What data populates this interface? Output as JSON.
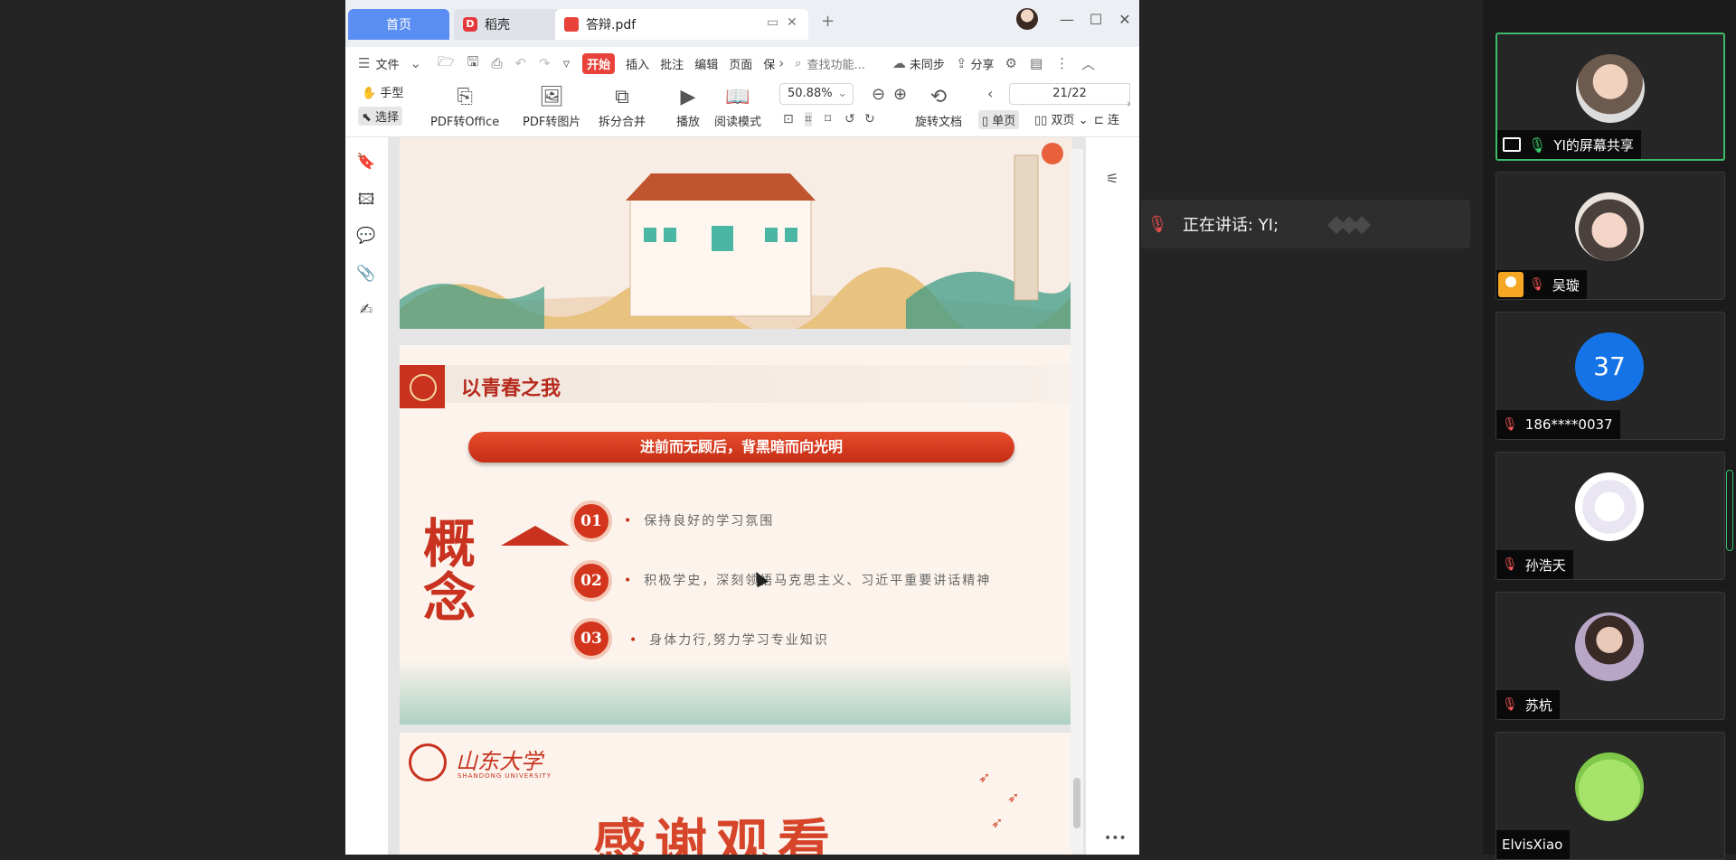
{
  "wps": {
    "tabs": {
      "home": "首页",
      "daoke": "稻壳",
      "pdf": "答辩.pdf"
    },
    "menu": {
      "file": "文件",
      "start": "开始",
      "insert": "插入",
      "annotate": "批注",
      "edit": "编辑",
      "page": "页面",
      "protect": "保",
      "search_placeholder": "查找功能...",
      "unsynced": "未同步",
      "share": "分享"
    },
    "toolbar": {
      "hand": "手型",
      "select": "选择",
      "to_office": "PDF转Office",
      "to_image": "PDF转图片",
      "split_merge": "拆分合并",
      "play": "播放",
      "read_mode": "阅读模式",
      "zoom": "50.88%",
      "page_indicator": "21/22",
      "rotate": "旋转文档",
      "single": "单页",
      "double": "双页",
      "continuous": "连"
    }
  },
  "slides": {
    "s2": {
      "title": "以青春之我",
      "banner": "进前而无顾后，背黑暗而向光明",
      "concept": "概念",
      "points": [
        {
          "num": "01",
          "text": "保持良好的学习氛围"
        },
        {
          "num": "02",
          "text": "积极学史，深刻领悟马克思主义、习近平重要讲话精神"
        },
        {
          "num": "03",
          "text": "身体力行,努力学习专业知识"
        }
      ]
    },
    "s3": {
      "school": "山东大学",
      "school_en": "SHANDONG UNIVERSITY",
      "thanks": "感谢观看"
    }
  },
  "meeting": {
    "speaking": "正在讲话: YI;",
    "participants": [
      {
        "name": "YI的屏幕共享"
      },
      {
        "name": "吴璇"
      },
      {
        "name": "186****0037",
        "badge": "37"
      },
      {
        "name": "孙浩天"
      },
      {
        "name": "苏杭"
      },
      {
        "name": "ElvisXiao"
      }
    ]
  },
  "colors": {
    "accent_red": "#c8321f",
    "tab_blue": "#5b8ef2",
    "active_green": "#3dbb6b",
    "badge_blue": "#1473e6"
  }
}
